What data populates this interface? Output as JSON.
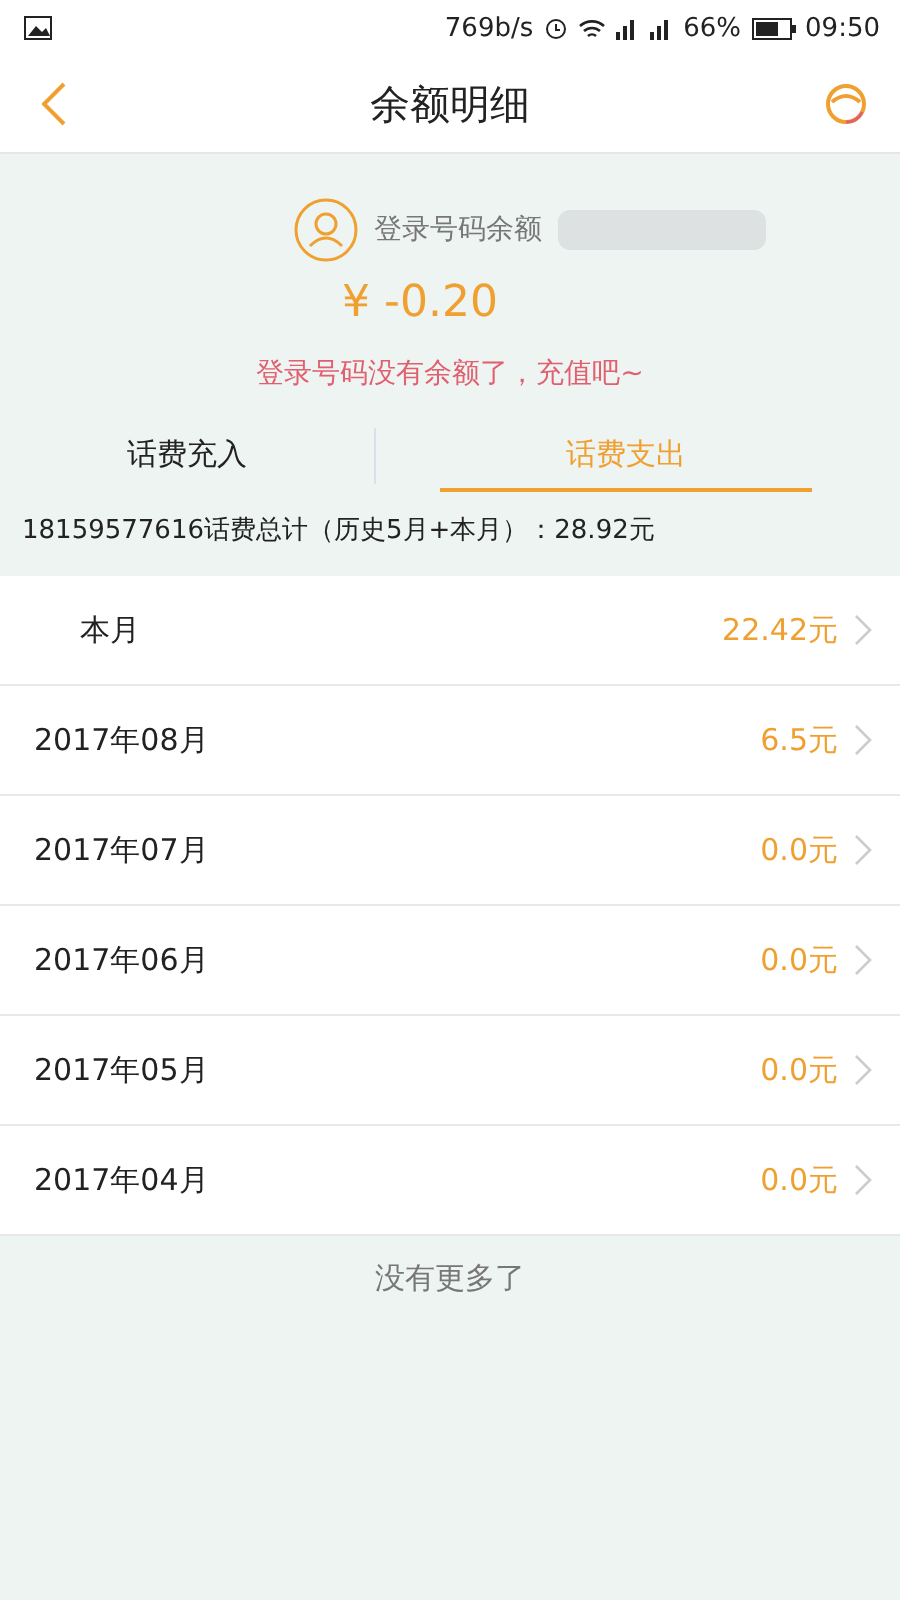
{
  "status_bar": {
    "speed": "769b/s",
    "battery": "66%",
    "time": "09:50"
  },
  "header": {
    "title": "余额明细"
  },
  "balance": {
    "label": "登录号码余额",
    "amount": "¥ -0.20",
    "notice": "登录号码没有余额了，充值吧~"
  },
  "tabs": [
    {
      "label": "话费充入",
      "selected": false
    },
    {
      "label": "话费支出",
      "selected": true
    }
  ],
  "summary": "18159577616话费总计（历史5月+本月）：28.92元",
  "months": [
    {
      "kind": "current",
      "label": "本月",
      "amount": "22.42元"
    },
    {
      "kind": "month",
      "label": "2017年08月",
      "amount": "6.5元"
    },
    {
      "kind": "month",
      "label": "2017年07月",
      "amount": "0.0元"
    },
    {
      "kind": "month",
      "label": "2017年06月",
      "amount": "0.0元"
    },
    {
      "kind": "month",
      "label": "2017年05月",
      "amount": "0.0元"
    },
    {
      "kind": "month",
      "label": "2017年04月",
      "amount": "0.0元"
    }
  ],
  "footer": "没有更多了"
}
